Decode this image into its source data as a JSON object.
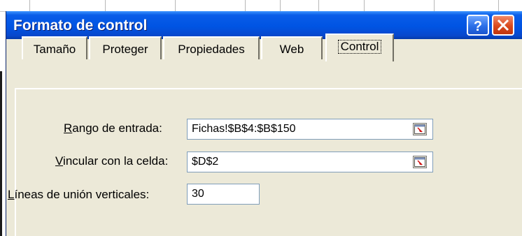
{
  "window": {
    "title": "Formato de control",
    "help_icon": "help-icon",
    "close_icon": "close-icon"
  },
  "tabs": [
    {
      "label": "Tamaño",
      "active": false
    },
    {
      "label": "Proteger",
      "active": false
    },
    {
      "label": "Propiedades",
      "active": false
    },
    {
      "label": "Web",
      "active": false
    },
    {
      "label": "Control",
      "active": true
    }
  ],
  "form": {
    "input_range": {
      "label_accel": "R",
      "label_rest": "ango de entrada:",
      "value": "Fichas!$B$4:$B$150",
      "icon": "collapse-dialog-icon"
    },
    "cell_link": {
      "label_accel": "V",
      "label_rest": "incular con la celda:",
      "value": "$D$2",
      "icon": "collapse-dialog-icon"
    },
    "drop_down_lines": {
      "label_accel": "L",
      "label_rest": "íneas de unión verticales:",
      "value": "30"
    }
  },
  "colors": {
    "titlebar": "#0054e3",
    "dialog_bg": "#ece9d8",
    "close_button": "#d9491d"
  }
}
